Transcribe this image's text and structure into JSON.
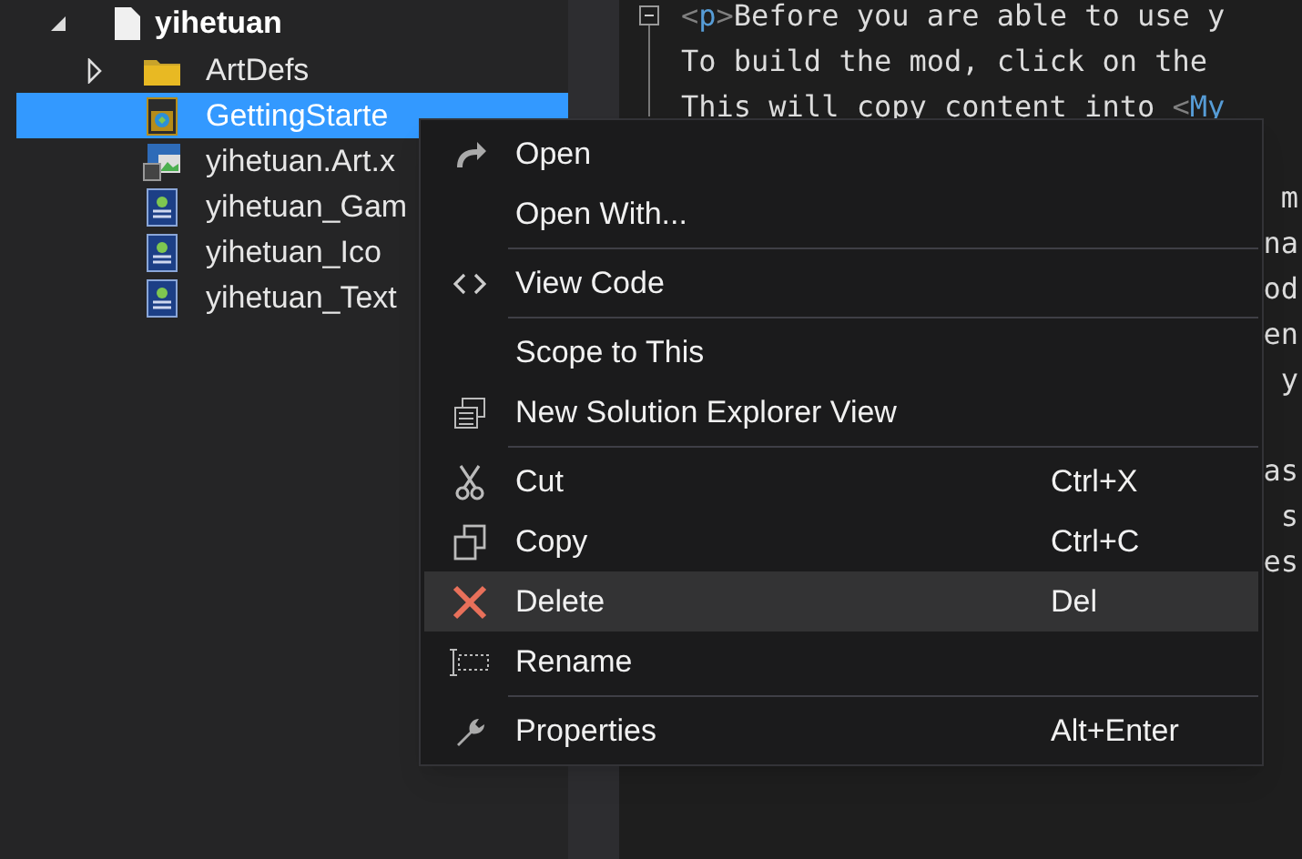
{
  "tree": {
    "label": "yihetuan",
    "expanded": true,
    "children": [
      {
        "label": "ArtDefs",
        "kind": "folder",
        "expanded": false,
        "selected": false
      },
      {
        "label": "GettingStarte",
        "kind": "html",
        "selected": true
      },
      {
        "label": "yihetuan.Art.x",
        "kind": "art",
        "selected": false
      },
      {
        "label": "yihetuan_Gam",
        "kind": "xml",
        "selected": false
      },
      {
        "label": "yihetuan_Ico",
        "kind": "xml",
        "selected": false
      },
      {
        "label": "yihetuan_Text",
        "kind": "xml",
        "selected": false
      }
    ]
  },
  "editor": {
    "lines": [
      {
        "kind": "full",
        "tokens": [
          {
            "t": "<",
            "kind": "punct"
          },
          {
            "t": "p",
            "kind": "tag"
          },
          {
            "t": ">",
            "kind": "punct"
          },
          {
            "t": "Before you are able to use y",
            "kind": "text"
          }
        ]
      },
      {
        "kind": "full",
        "tokens": [
          {
            "t": "To build the mod, click on the",
            "kind": "text"
          }
        ]
      },
      {
        "kind": "full",
        "tokens": [
          {
            "t": "This will copy content into ",
            "kind": "text"
          },
          {
            "t": "<",
            "kind": "punct"
          },
          {
            "t": "My",
            "kind": "tag"
          }
        ]
      },
      {
        "kind": "blank"
      },
      {
        "kind": "edge",
        "text": "m"
      },
      {
        "kind": "edge",
        "text": "na"
      },
      {
        "kind": "edge",
        "text": "od"
      },
      {
        "kind": "edge",
        "text": "en"
      },
      {
        "kind": "edge",
        "text": "y"
      },
      {
        "kind": "blank"
      },
      {
        "kind": "edge",
        "text": "as"
      },
      {
        "kind": "edge",
        "text": "s"
      },
      {
        "kind": "edge",
        "text": "es"
      }
    ]
  },
  "context_menu": {
    "items": [
      {
        "kind": "item",
        "label": "Open",
        "selected": false
      },
      {
        "kind": "item",
        "label": "Open With...",
        "selected": false
      },
      {
        "kind": "separator"
      },
      {
        "kind": "item",
        "label": "View Code",
        "selected": false
      },
      {
        "kind": "separator"
      },
      {
        "kind": "item",
        "label": "Scope to This",
        "selected": false
      },
      {
        "kind": "item",
        "label": "New Solution Explorer View",
        "selected": false
      },
      {
        "kind": "separator"
      },
      {
        "kind": "item",
        "label": "Cut",
        "shortcut": "Ctrl+X",
        "selected": false
      },
      {
        "kind": "item",
        "label": "Copy",
        "shortcut": "Ctrl+C",
        "selected": false
      },
      {
        "kind": "item",
        "label": "Delete",
        "shortcut": "Del",
        "selected": true
      },
      {
        "kind": "item",
        "label": "Rename",
        "selected": false
      },
      {
        "kind": "separator"
      },
      {
        "kind": "item",
        "label": "Properties",
        "shortcut": "Alt+Enter",
        "selected": false
      }
    ]
  }
}
